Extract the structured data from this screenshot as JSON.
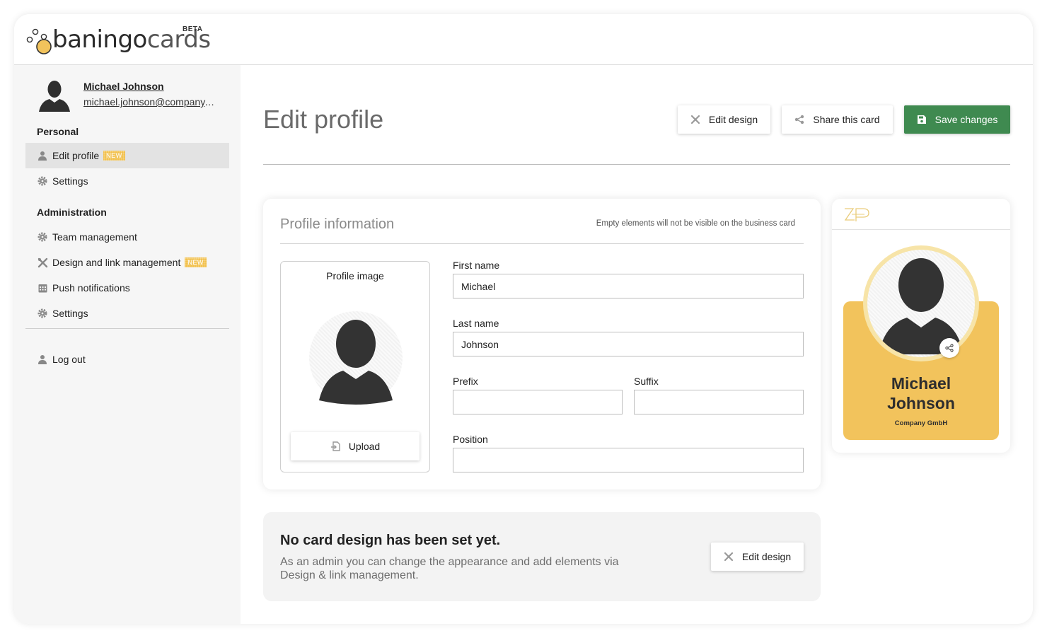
{
  "app": {
    "logo_text_bold": "baningo",
    "logo_text_light": "cards",
    "logo_badge": "BETA"
  },
  "user": {
    "name": "Michael Johnson",
    "email": "michael.johnson@company.com"
  },
  "sidebar": {
    "personal_heading": "Personal",
    "admin_heading": "Administration",
    "items": [
      {
        "label": "Edit profile",
        "icon": "user-icon",
        "badge": "NEW",
        "active": true
      },
      {
        "label": "Settings",
        "icon": "gear-icon"
      },
      {
        "label": "Team management",
        "icon": "gear-icon"
      },
      {
        "label": "Design and link management",
        "icon": "tools-icon",
        "badge": "NEW"
      },
      {
        "label": "Push notifications",
        "icon": "calendar-icon"
      },
      {
        "label": "Settings",
        "icon": "gear-icon"
      },
      {
        "label": "Log out",
        "icon": "user-icon"
      }
    ]
  },
  "header": {
    "title": "Edit profile",
    "edit_design": "Edit design",
    "share_card": "Share this card",
    "save_changes": "Save changes"
  },
  "profile": {
    "title": "Profile information",
    "hint": "Empty elements will not be visible on the business card",
    "image_label": "Profile image",
    "upload_label": "Upload",
    "fields": {
      "first_name_label": "First name",
      "first_name_value": "Michael",
      "last_name_label": "Last name",
      "last_name_value": "Johnson",
      "prefix_label": "Prefix",
      "prefix_value": "",
      "suffix_label": "Suffix",
      "suffix_value": "",
      "position_label": "Position",
      "position_value": ""
    }
  },
  "preview": {
    "name_line1": "Michael",
    "name_line2": "Johnson",
    "company": "Company GmbH",
    "accent_color": "#f2c35c"
  },
  "notice": {
    "title": "No card design has been set yet.",
    "text": "As an admin you can change the appearance and add elements via Design & link management.",
    "button": "Edit design"
  },
  "colors": {
    "primary_button": "#3f8a50",
    "badge": "#f2c14e"
  }
}
